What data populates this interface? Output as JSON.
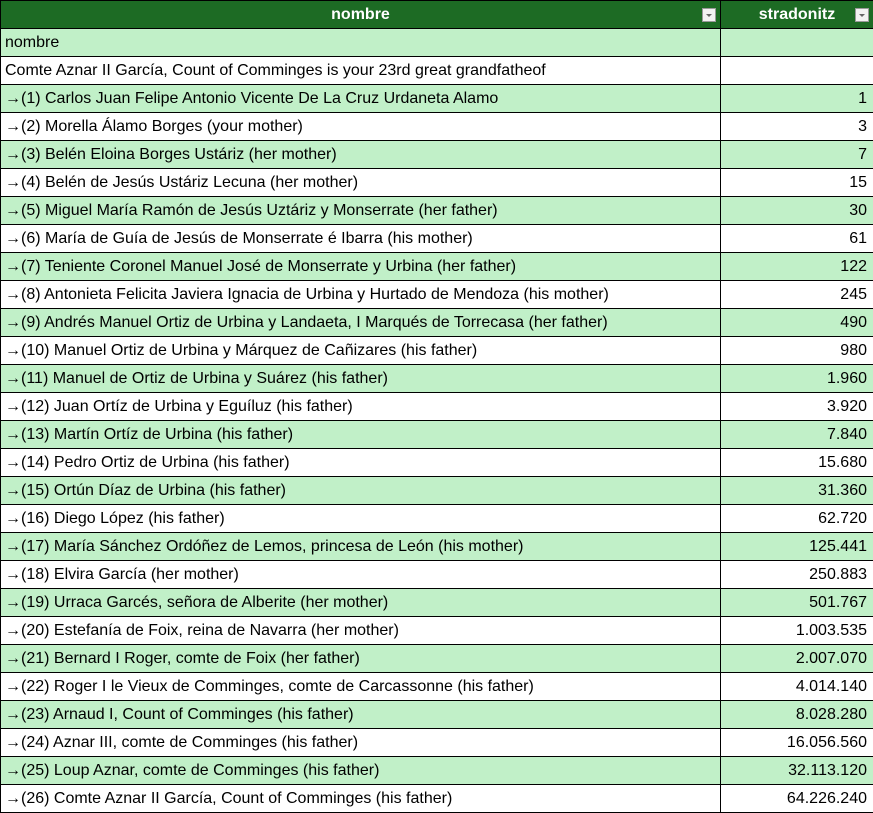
{
  "header": {
    "col1": "nombre",
    "col2": "stradonitz"
  },
  "rows": [
    {
      "name": "nombre",
      "num": ""
    },
    {
      "name": "Comte Aznar II García, Count of Comminges is your 23rd great grandfatheof",
      "num": ""
    },
    {
      "name": "→(1) Carlos Juan Felipe Antonio Vicente De La Cruz Urdaneta Alamo",
      "num": "1"
    },
    {
      "name": "→(2)  Morella Álamo Borges (your mother)",
      "num": "3"
    },
    {
      "name": "→(3) Belén Eloina Borges Ustáriz (her mother)",
      "num": "7"
    },
    {
      "name": "→(4) Belén de Jesús Ustáriz Lecuna (her mother)",
      "num": "15"
    },
    {
      "name": "→(5) Miguel María Ramón de Jesús Uztáriz y Monserrate (her father)",
      "num": "30"
    },
    {
      "name": "→(6) María de Guía de Jesús de Monserrate é Ibarra (his mother)",
      "num": "61"
    },
    {
      "name": "→(7) Teniente Coronel Manuel José de Monserrate y Urbina (her father)",
      "num": "122"
    },
    {
      "name": "→(8) Antonieta Felicita Javiera Ignacia de Urbina y Hurtado de Mendoza (his mother)",
      "num": "245"
    },
    {
      "name": "→(9) Andrés Manuel Ortiz de Urbina y Landaeta, I Marqués de Torrecasa (her father)",
      "num": "490"
    },
    {
      "name": "→(10) Manuel Ortiz de Urbina y Márquez de Cañizares (his father)",
      "num": "980"
    },
    {
      "name": "→(11) Manuel de Ortiz de Urbina y Suárez (his father)",
      "num": "1.960"
    },
    {
      "name": "→(12) Juan Ortíz de Urbina y Eguíluz (his father)",
      "num": "3.920"
    },
    {
      "name": "→(13) Martín Ortíz de Urbina (his father)",
      "num": "7.840"
    },
    {
      "name": "→(14) Pedro Ortiz de Urbina (his father)",
      "num": "15.680"
    },
    {
      "name": "→(15) Ortún Díaz de Urbina (his father)",
      "num": "31.360"
    },
    {
      "name": "→(16) Diego López (his father)",
      "num": "62.720"
    },
    {
      "name": "→(17) María Sánchez Ordóñez de Lemos, princesa de León (his mother)",
      "num": "125.441"
    },
    {
      "name": "→(18) Elvira García (her mother)",
      "num": "250.883"
    },
    {
      "name": "→(19) Urraca Garcés, señora de Alberite (her mother)",
      "num": "501.767"
    },
    {
      "name": "→(20) Estefanía de Foix, reina de Navarra (her mother)",
      "num": "1.003.535"
    },
    {
      "name": "→(21) Bernard I Roger, comte de Foix (her father)",
      "num": "2.007.070"
    },
    {
      "name": "→(22) Roger I le Vieux de Comminges, comte de Carcassonne (his father)",
      "num": "4.014.140"
    },
    {
      "name": "→(23) Arnaud I, Count of Comminges (his father)",
      "num": "8.028.280"
    },
    {
      "name": "→(24) Aznar III, comte de Comminges (his father)",
      "num": "16.056.560"
    },
    {
      "name": "→(25) Loup Aznar, comte de Comminges (his father)",
      "num": "32.113.120"
    },
    {
      "name": "→(26) Comte Aznar II García, Count of Comminges (his father)",
      "num": "64.226.240"
    }
  ]
}
